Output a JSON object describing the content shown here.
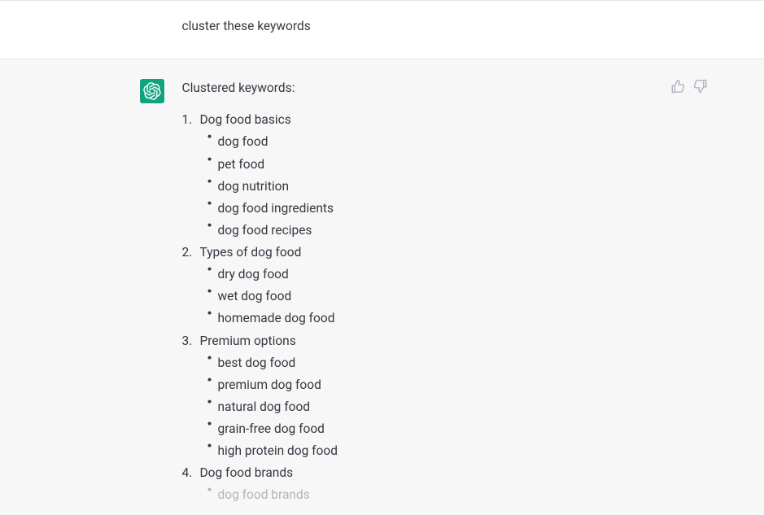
{
  "user": {
    "message": "cluster these keywords"
  },
  "assistant": {
    "intro": "Clustered keywords:",
    "clusters": [
      {
        "title": "Dog food basics",
        "items": [
          {
            "text": "dog food",
            "fade": false
          },
          {
            "text": "pet food",
            "fade": false
          },
          {
            "text": "dog nutrition",
            "fade": false
          },
          {
            "text": "dog food ingredients",
            "fade": false
          },
          {
            "text": "dog food recipes",
            "fade": false
          }
        ]
      },
      {
        "title": "Types of dog food",
        "items": [
          {
            "text": "dry dog food",
            "fade": false
          },
          {
            "text": "wet dog food",
            "fade": false
          },
          {
            "text": "homemade dog food",
            "fade": false
          }
        ]
      },
      {
        "title": "Premium options",
        "items": [
          {
            "text": "best dog food",
            "fade": false
          },
          {
            "text": "premium dog food",
            "fade": false
          },
          {
            "text": "natural dog food",
            "fade": false
          },
          {
            "text": "grain-free dog food",
            "fade": false
          },
          {
            "text": "high protein dog food",
            "fade": false
          }
        ]
      },
      {
        "title": "Dog food brands",
        "items": [
          {
            "text": "dog food brands",
            "fade": true
          }
        ]
      }
    ]
  }
}
